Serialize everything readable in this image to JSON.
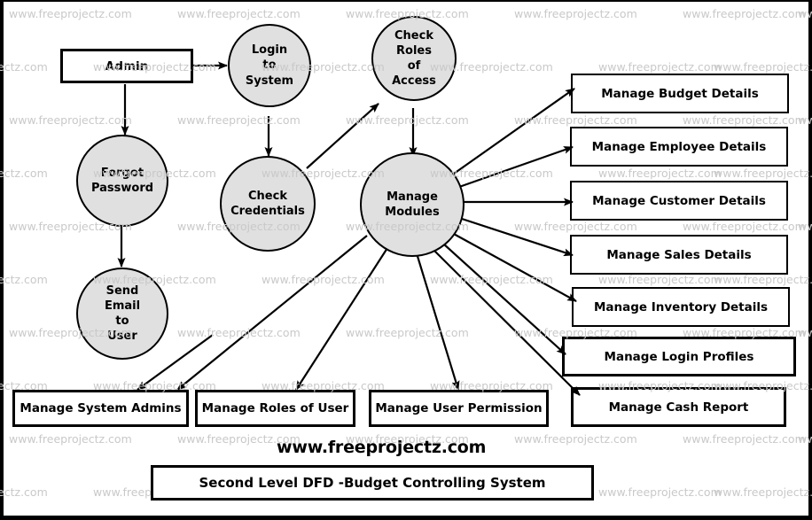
{
  "diagram": {
    "title": "Second Level DFD -Budget Controlling System",
    "site_text": "www.freeprojectz.com",
    "watermark_text": "www.freeprojectz.com",
    "colors": {
      "process_fill": "#e0e0e0",
      "stroke": "#000000",
      "watermark": "#c9c9c9",
      "background": "#ffffff"
    },
    "entities": [
      {
        "id": "admin",
        "label": "Admin",
        "shape": "rectangle"
      }
    ],
    "processes": [
      {
        "id": "login_to_system",
        "label": "Login\nto\nSystem",
        "shape": "circle"
      },
      {
        "id": "check_roles",
        "label": "Check\nRoles\nof\nAccess",
        "shape": "circle"
      },
      {
        "id": "forgot_password",
        "label": "Forgot\nPassword",
        "shape": "circle"
      },
      {
        "id": "check_credentials",
        "label": "Check\nCredentials",
        "shape": "circle"
      },
      {
        "id": "manage_modules",
        "label": "Manage\nModules",
        "shape": "circle"
      },
      {
        "id": "send_email",
        "label": "Send\nEmail\nto\nUser",
        "shape": "circle"
      }
    ],
    "right_boxes": [
      {
        "id": "budget",
        "label": "Manage Budget Details"
      },
      {
        "id": "employee",
        "label": "Manage Employee Details"
      },
      {
        "id": "customer",
        "label": "Manage Customer Details"
      },
      {
        "id": "sales",
        "label": "Manage Sales Details"
      },
      {
        "id": "inventory",
        "label": "Manage Inventory Details"
      },
      {
        "id": "login",
        "label": "Manage Login Profiles"
      },
      {
        "id": "cash",
        "label": "Manage Cash Report"
      }
    ],
    "bottom_boxes": [
      {
        "id": "system_admins",
        "label": "Manage System Admins"
      },
      {
        "id": "roles_of_user",
        "label": "Manage Roles of User"
      },
      {
        "id": "user_permission",
        "label": "Manage User Permission"
      },
      {
        "id": "cash_report",
        "label": "Manage Cash Report"
      }
    ],
    "flows": [
      {
        "from": "admin",
        "to": "login_to_system"
      },
      {
        "from": "admin",
        "to": "forgot_password"
      },
      {
        "from": "login_to_system",
        "to": "check_credentials"
      },
      {
        "from": "check_credentials",
        "to": "check_roles"
      },
      {
        "from": "check_roles",
        "to": "manage_modules"
      },
      {
        "from": "forgot_password",
        "to": "send_email"
      },
      {
        "from": "send_email",
        "to": "system_admins"
      },
      {
        "from": "manage_modules",
        "to": "budget"
      },
      {
        "from": "manage_modules",
        "to": "employee"
      },
      {
        "from": "manage_modules",
        "to": "customer"
      },
      {
        "from": "manage_modules",
        "to": "sales"
      },
      {
        "from": "manage_modules",
        "to": "inventory"
      },
      {
        "from": "manage_modules",
        "to": "login"
      },
      {
        "from": "manage_modules",
        "to": "cash"
      },
      {
        "from": "manage_modules",
        "to": "system_admins"
      },
      {
        "from": "manage_modules",
        "to": "roles_of_user"
      },
      {
        "from": "manage_modules",
        "to": "user_permission"
      },
      {
        "from": "manage_modules",
        "to": "cash_report"
      }
    ]
  }
}
